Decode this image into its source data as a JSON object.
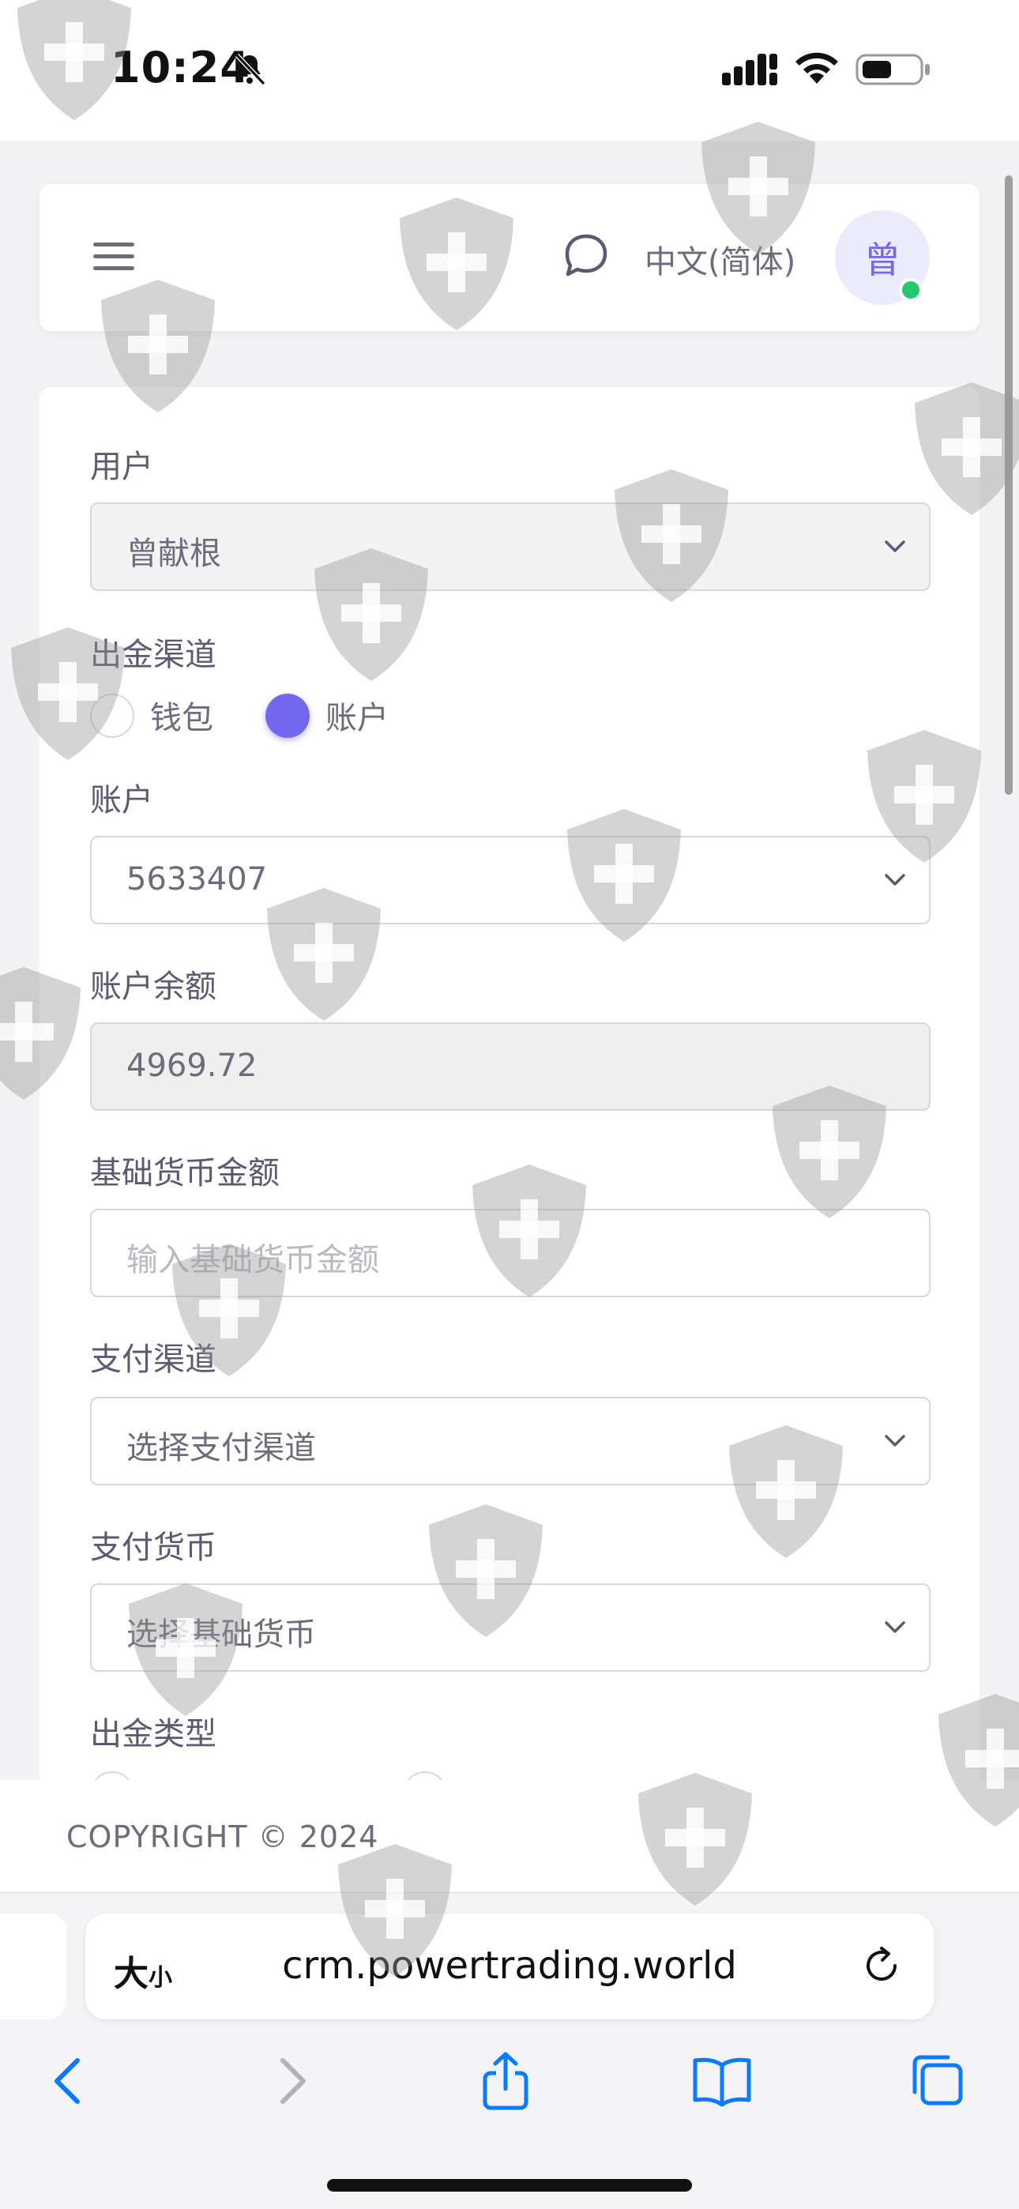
{
  "status_bar": {
    "time": "10:24"
  },
  "header": {
    "menu_icon": "hamburger-menu-icon",
    "chat_icon": "chat-bubble-icon",
    "language": "中文(简体)",
    "avatar_initial": "曾",
    "avatar_status_color": "#28c76f"
  },
  "form": {
    "user": {
      "label": "用户",
      "value": "曾献根"
    },
    "withdraw_channel": {
      "label": "出金渠道",
      "options": [
        {
          "label": "钱包",
          "selected": false
        },
        {
          "label": "账户",
          "selected": true
        }
      ]
    },
    "account": {
      "label": "账户",
      "value": "5633407"
    },
    "account_balance": {
      "label": "账户余额",
      "value": "4969.72"
    },
    "base_amount": {
      "label": "基础货币金额",
      "placeholder": "输入基础货币金额"
    },
    "payment_channel": {
      "label": "支付渠道",
      "value": "选择支付渠道"
    },
    "payment_currency": {
      "label": "支付货币",
      "value": "选择基础货币"
    },
    "withdraw_type": {
      "label": "出金类型"
    }
  },
  "footer": {
    "copyright": "COPYRIGHT © 2024"
  },
  "browser": {
    "text_size_label": "大",
    "text_size_small": "小",
    "url": "crm.powertrading.world"
  },
  "colors": {
    "accent": "#7367f0",
    "online": "#28c76f",
    "ios_blue": "#0a7aff"
  }
}
